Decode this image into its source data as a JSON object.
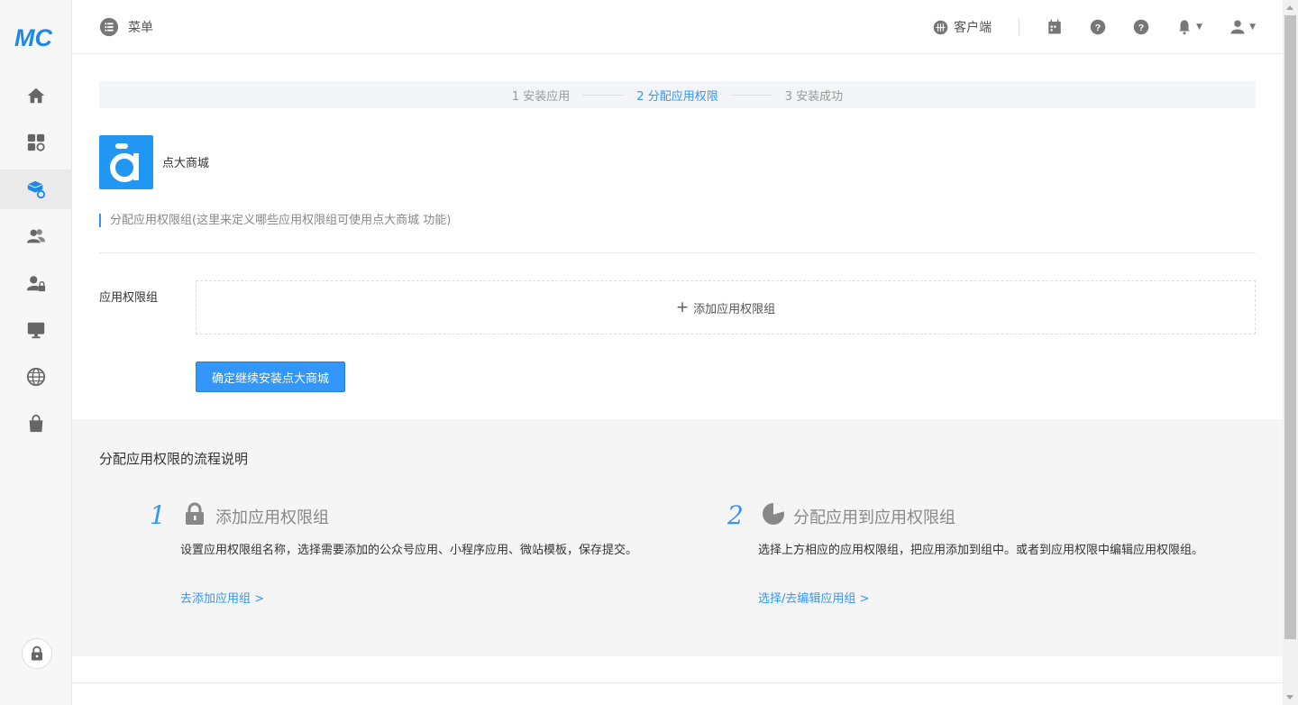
{
  "brand": {
    "logo_text": "MC",
    "color": "#1e88e5"
  },
  "topbar": {
    "menu_label": "菜单",
    "client_label": "客户端"
  },
  "sidebar": {
    "items": [
      {
        "icon": "home-icon"
      },
      {
        "icon": "apps-icon"
      },
      {
        "icon": "app-install-icon",
        "active": true
      },
      {
        "icon": "users-icon"
      },
      {
        "icon": "user-lock-icon"
      },
      {
        "icon": "monitor-icon"
      },
      {
        "icon": "globe-icon"
      },
      {
        "icon": "shopping-bag-icon"
      }
    ],
    "lock_icon": "lock-icon"
  },
  "steps": {
    "step1": "1 安装应用",
    "step2": "2 分配应用权限",
    "step3": "3 安装成功",
    "active": 2
  },
  "app": {
    "name": "点大商城"
  },
  "section": {
    "desc": "分配应用权限组(这里来定义哪些应用权限组可使用点大商城 功能)"
  },
  "form": {
    "label": "应用权限组",
    "add_label": "添加应用权限组",
    "confirm_label": "确定继续安装点大商城"
  },
  "flow": {
    "title": "分配应用权限的流程说明",
    "steps": [
      {
        "num": "1",
        "title": "添加应用权限组",
        "desc": "设置应用权限组名称，选择需要添加的公众号应用、小程序应用、微站模板，保存提交。",
        "link": "去添加应用组 >"
      },
      {
        "num": "2",
        "title": "分配应用到应用权限组",
        "desc": "选择上方相应的应用权限组，把应用添加到组中。或者到应用权限中编辑应用权限组。",
        "link": "选择/去编辑应用组 >"
      }
    ]
  },
  "colors": {
    "accent": "#3296fa",
    "sidebar_bg": "#f7f7f7",
    "flow_bg": "#f5f5f5"
  }
}
